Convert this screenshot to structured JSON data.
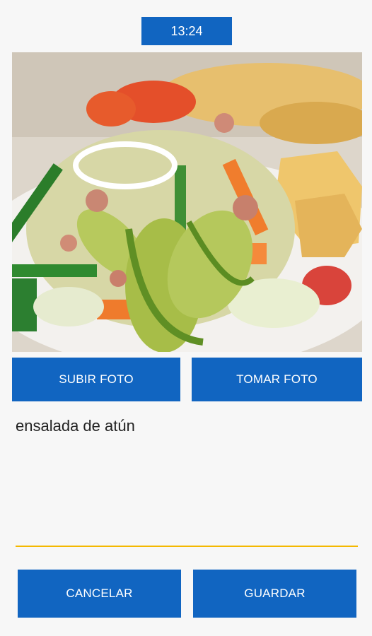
{
  "status": {
    "time": "13:24"
  },
  "photo": {
    "subject": "tuna-salad-photo"
  },
  "buttons": {
    "upload": "SUBIR FOTO",
    "take": "TOMAR FOTO",
    "cancel": "CANCELAR",
    "save": "GUARDAR"
  },
  "dish": {
    "name": "ensalada de atún"
  },
  "colors": {
    "accent": "#1165c1",
    "underline": "#f4b800",
    "background": "#f7f7f7"
  }
}
